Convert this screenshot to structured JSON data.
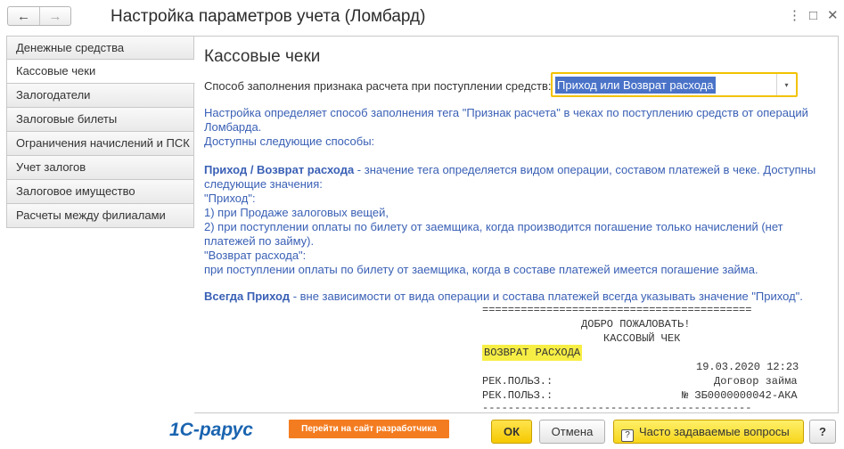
{
  "window": {
    "title": "Настройка параметров учета (Ломбард)",
    "back_icon": "←",
    "forward_icon": "→",
    "menu_icon": "⋮",
    "maximize_icon": "□",
    "close_icon": "✕"
  },
  "sidebar": {
    "items": [
      {
        "label": "Денежные средства"
      },
      {
        "label": "Кассовые чеки"
      },
      {
        "label": "Залогодатели"
      },
      {
        "label": "Залоговые билеты"
      },
      {
        "label": "Ограничения начислений и ПСК"
      },
      {
        "label": "Учет залогов"
      },
      {
        "label": "Залоговое имущество"
      },
      {
        "label": "Расчеты между филиалами"
      }
    ],
    "active_index": 1
  },
  "content": {
    "title": "Кассовые чеки",
    "field_label": "Способ заполнения признака расчета при поступлении средств:",
    "field_value": "Приход или Возврат расхода",
    "select_arrow": "▾",
    "paragraphs": {
      "p1": "Настройка определяет способ заполнения тега \"Признак расчета\" в чеках по поступлению средств от операций Ломбарда.",
      "p2": "Доступны следующие способы:",
      "p3_bold": "Приход / Возврат расхода",
      "p3_rest": " - значение тега определяется видом операции, составом платежей в чеке. Доступны следующие значения:",
      "p4": "\"Приход\":",
      "p5": "1) при Продаже залоговых вещей,",
      "p6": "2) при поступлении оплаты по билету от заемщика, когда производится погашение только начислений (нет платежей по займу).",
      "p7": "\"Возврат расхода\":",
      "p8": "при поступлении оплаты по билету от заемщика, когда в составе платежей имеется погашение займа.",
      "p9_bold": "Всегда Приход",
      "p9_rest": " - вне зависимости от вида операции и состава платежей всегда указывать значение \"Приход\"."
    }
  },
  "receipt": {
    "separator_top": "==========================================",
    "welcome": "ДОБРО ПОЖАЛОВАТЬ!",
    "receipt_title": "КАССОВЫЙ ЧЕК",
    "type_highlight": "ВОЗВРАТ РАСХОДА",
    "datetime": "19.03.2020 12:23",
    "req1_label": "РЕК.ПОЛЬЗ.:",
    "req1_value": "Договор займа",
    "req2_label": "РЕК.ПОЛЬЗ.:",
    "req2_value": "№ ЗБ0000000042-АКА",
    "separator_bottom": "------------------------------------------"
  },
  "footer": {
    "logo_text": "1С-рарус",
    "developer_link": "Перейти на сайт разработчика",
    "ok_label": "ОК",
    "cancel_label": "Отмена",
    "faq_label": "Часто задаваемые вопросы",
    "faq_icon": "?",
    "help_label": "?"
  },
  "colors": {
    "accent_yellow": "#f5c800",
    "select_highlight": "#4a73c8",
    "description_text": "#3a60b5",
    "developer_button": "#f47c20",
    "receipt_highlight": "#f7ee45"
  }
}
